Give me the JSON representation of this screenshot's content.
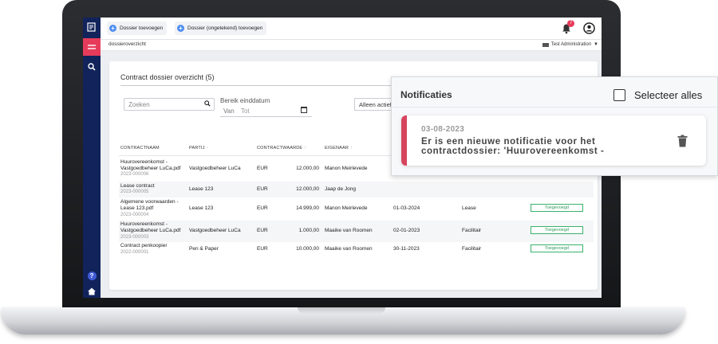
{
  "app": {
    "colors": {
      "sidebar": "#11235a",
      "accent": "#e63b5a",
      "primary_button": "#4f8ff0",
      "status_green": "#2b9a58"
    }
  },
  "topbar": {
    "add_dossier_label": "Dossier toevoegen",
    "add_unsigned_dossier_label": "Dossier (ongetekend) toevoegen",
    "notification_count": "7"
  },
  "subheader": {
    "breadcrumb": "dossieroverzicht",
    "administration": "Test Administration"
  },
  "main": {
    "title": "Contract dossier overzicht (5)",
    "search_placeholder": "Zoeken",
    "range_label": "Bereik einddatum",
    "range_from": "Van",
    "range_to": "Tot",
    "filter_value": "Alleen actief",
    "columns": [
      "CONTRACTNAAM",
      "PARTIJ",
      "CONTRACTWAARDE",
      "EIGENAAR"
    ],
    "rows": [
      {
        "name1": "Huurovereenkomst -",
        "name2": "Vastgoedbeheer LuCa.pdf",
        "id": "2023-000006",
        "party": "Vastgoedbeheer LuCa",
        "currency": "EUR",
        "value": "12.000,00",
        "owner": "Manon Meirlevede",
        "date": "",
        "category": "",
        "status": ""
      },
      {
        "name1": "Lease contract",
        "name2": "",
        "id": "2023-000005",
        "party": "Lease 123",
        "currency": "EUR",
        "value": "12.000,00",
        "owner": "Jaap de Jong",
        "date": "",
        "category": "",
        "status": ""
      },
      {
        "name1": "Algemene voorwaarden -",
        "name2": "Lease 123.pdf",
        "id": "2023-000004",
        "party": "Lease 123",
        "currency": "EUR",
        "value": "14.999,00",
        "owner": "Manon Meirlevede",
        "date": "01-03-2024",
        "category": "Lease",
        "status": "Toegevoegd"
      },
      {
        "name1": "Huurovereenkomst -",
        "name2": "Vastgoedbeheer LuCa.pdf",
        "id": "2023-000003",
        "party": "Vastgoedbeheer LuCa",
        "currency": "EUR",
        "value": "1.000,00",
        "owner": "Maaike van Roomen",
        "date": "02-01-2023",
        "category": "Facilitair",
        "status": "Toegevoegd"
      },
      {
        "name1": "Contract penkoopier",
        "name2": "",
        "id": "2022-000001",
        "party": "Pen & Paper",
        "currency": "EUR",
        "value": "10.000,00",
        "owner": "Maaike van Roomen",
        "date": "30-11-2023",
        "category": "Facilitair",
        "status": "Toegevoegd"
      }
    ]
  },
  "notifications": {
    "title": "Notificaties",
    "select_all_label": "Selecteer alles",
    "items": [
      {
        "date": "03-08-2023",
        "message": "Er is een nieuwe notificatie voor het contractdossier: 'Huurovereenkomst -"
      }
    ]
  }
}
